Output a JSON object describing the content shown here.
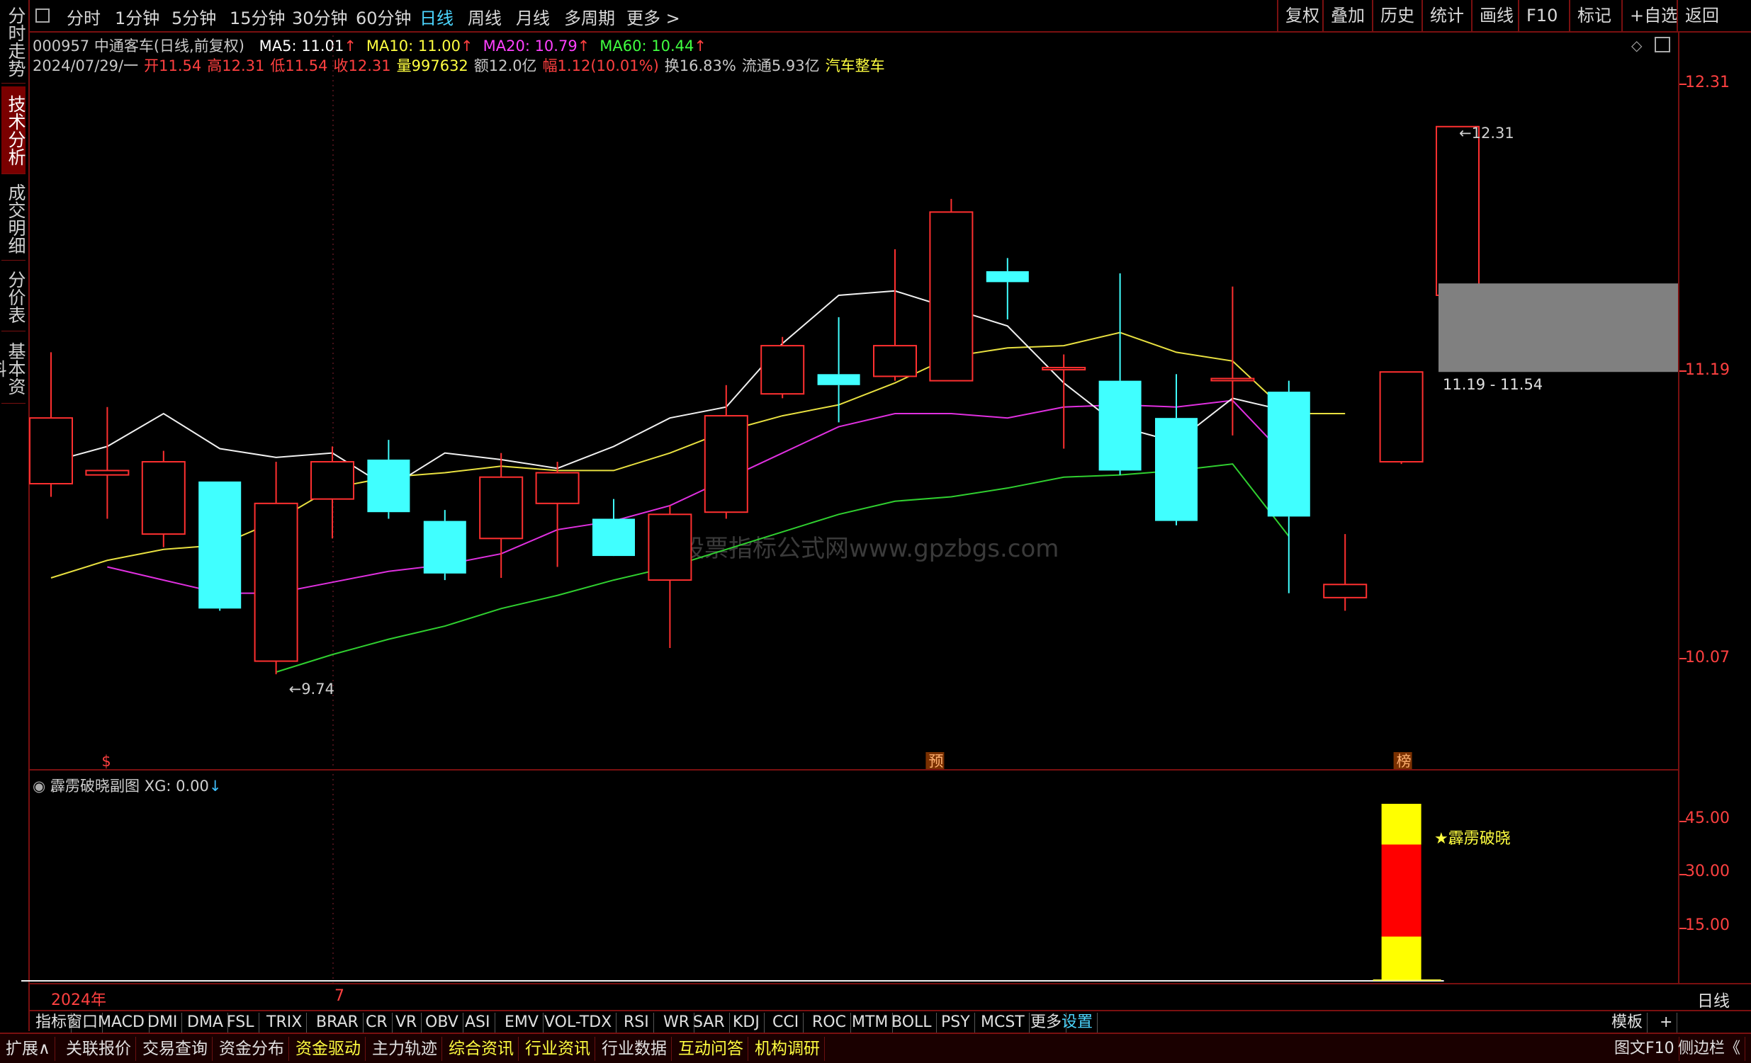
{
  "sidebar": [
    "分时走势",
    "技术分析",
    "成交明细",
    "分价表",
    "基本资料"
  ],
  "periods": [
    "分时",
    "1分钟",
    "5分钟",
    "15分钟",
    "30分钟",
    "60分钟",
    "日线",
    "周线",
    "月线",
    "多周期",
    "更多 >"
  ],
  "active_period": "日线",
  "toolbar": [
    "复权",
    "叠加",
    "历史",
    "统计",
    "画线",
    "F10",
    "标记",
    "+自选",
    "返回"
  ],
  "stock": {
    "code_name": "000957 中通客车(日线,前复权)"
  },
  "ma": [
    {
      "label": "MA5: 11.01",
      "color": "#ffffff"
    },
    {
      "label": "MA10: 11.00",
      "color": "#ffff40"
    },
    {
      "label": "MA20: 10.79",
      "color": "#ff40ff"
    },
    {
      "label": "MA60: 10.44",
      "color": "#40ff40"
    }
  ],
  "quote": [
    {
      "t": "2024/07/29/一",
      "c": "#c8c8c8"
    },
    {
      "t": "开11.54",
      "c": "#ff4040"
    },
    {
      "t": "高12.31",
      "c": "#ff4040"
    },
    {
      "t": "低11.54",
      "c": "#ff4040"
    },
    {
      "t": "收12.31",
      "c": "#ff4040"
    },
    {
      "t": "量997632",
      "c": "#ffff40"
    },
    {
      "t": "额12.0亿",
      "c": "#c8c8c8"
    },
    {
      "t": "幅1.12(10.01%)",
      "c": "#ff4040"
    },
    {
      "t": "换16.83%",
      "c": "#c8c8c8"
    },
    {
      "t": "流通5.93亿",
      "c": "#c8c8c8"
    },
    {
      "t": "汽车整车",
      "c": "#ffff40"
    }
  ],
  "price_axis": [
    "12.31",
    "11.19",
    "10.07"
  ],
  "vol_axis": [
    "45.00",
    "30.00",
    "15.00"
  ],
  "annotations": {
    "high": "12.31",
    "low": "9.74",
    "gap": "11.19 - 11.54",
    "markers": [
      "$",
      "预",
      "榜"
    ]
  },
  "watermark": "股票指标公式网www.gpzbgs.com",
  "sub_title": "霹雳破晓副图",
  "xg": "XG: 0.00",
  "signal_label": "霹雳破晓",
  "timeline": {
    "year": "2024年",
    "month": "7"
  },
  "period_indicator": "日线",
  "indicators": [
    "指标",
    "窗口",
    "MACD",
    "DMI",
    "DMA",
    "FSL",
    "TRIX",
    "BRAR",
    "CR",
    "VR",
    "OBV",
    "ASI",
    "EMV",
    "VOL-TDX",
    "RSI",
    "WR",
    "SAR",
    "KDJ",
    "CCI",
    "ROC",
    "MTM",
    "BOLL",
    "PSY",
    "MCST",
    "更多",
    "设置"
  ],
  "indicator_right": [
    "模板",
    "+"
  ],
  "bottom": [
    "扩展∧",
    "关联报价",
    "交易查询",
    "资金分布",
    "资金驱动",
    "主力轨迹",
    "综合资讯",
    "行业资讯",
    "行业数据",
    "互动问答",
    "机构调研"
  ],
  "bottom_right": [
    "图文F10",
    "侧边栏《"
  ],
  "chart_data": {
    "type": "candlestick",
    "price_range": [
      9.5,
      12.5
    ],
    "candles": [
      {
        "o": 10.68,
        "c": 10.98,
        "h": 11.28,
        "l": 10.62
      },
      {
        "o": 10.72,
        "c": 10.74,
        "h": 11.03,
        "l": 10.52
      },
      {
        "o": 10.45,
        "c": 10.78,
        "h": 10.83,
        "l": 10.39
      },
      {
        "o": 10.69,
        "c": 10.11,
        "h": 10.69,
        "l": 10.1
      },
      {
        "o": 9.87,
        "c": 10.59,
        "h": 10.78,
        "l": 9.81
      },
      {
        "o": 10.61,
        "c": 10.78,
        "h": 10.85,
        "l": 10.43
      },
      {
        "o": 10.79,
        "c": 10.55,
        "h": 10.88,
        "l": 10.52
      },
      {
        "o": 10.51,
        "c": 10.27,
        "h": 10.56,
        "l": 10.24
      },
      {
        "o": 10.43,
        "c": 10.71,
        "h": 10.82,
        "l": 10.25
      },
      {
        "o": 10.59,
        "c": 10.73,
        "h": 10.78,
        "l": 10.3
      },
      {
        "o": 10.52,
        "c": 10.35,
        "h": 10.61,
        "l": 10.37
      },
      {
        "o": 10.24,
        "c": 10.54,
        "h": 10.58,
        "l": 9.93
      },
      {
        "o": 10.55,
        "c": 10.99,
        "h": 11.13,
        "l": 10.52
      },
      {
        "o": 11.09,
        "c": 11.31,
        "h": 11.35,
        "l": 11.07
      },
      {
        "o": 11.18,
        "c": 11.13,
        "h": 11.44,
        "l": 10.96
      },
      {
        "o": 11.17,
        "c": 11.31,
        "h": 11.75,
        "l": 11.15
      },
      {
        "o": 11.15,
        "c": 11.92,
        "h": 11.98,
        "l": 11.15
      },
      {
        "o": 11.65,
        "c": 11.6,
        "h": 11.71,
        "l": 11.43
      },
      {
        "o": 11.21,
        "c": 11.21,
        "h": 11.27,
        "l": 10.84
      },
      {
        "o": 11.15,
        "c": 10.74,
        "h": 11.64,
        "l": 10.72
      },
      {
        "o": 10.98,
        "c": 10.51,
        "h": 11.18,
        "l": 10.49
      },
      {
        "o": 11.16,
        "c": 11.16,
        "h": 11.58,
        "l": 10.9
      },
      {
        "o": 11.1,
        "c": 10.53,
        "h": 11.15,
        "l": 10.18
      },
      {
        "o": 10.16,
        "c": 10.22,
        "h": 10.45,
        "l": 10.1
      },
      {
        "o": 10.78,
        "c": 11.19,
        "h": 11.19,
        "l": 10.77
      },
      {
        "o": 11.54,
        "c": 12.31,
        "h": 12.31,
        "l": 11.54
      }
    ],
    "ma5": [
      10.78,
      10.85,
      11.0,
      10.84,
      10.8,
      10.82,
      10.66,
      10.82,
      10.79,
      10.75,
      10.85,
      10.98,
      11.03,
      11.32,
      11.54,
      11.56,
      11.48,
      11.4,
      11.14,
      10.94,
      10.87,
      11.07,
      11.01
    ],
    "ma10": [
      10.25,
      10.33,
      10.38,
      10.4,
      10.51,
      10.66,
      10.71,
      10.73,
      10.76,
      10.74,
      10.74,
      10.82,
      10.92,
      10.99,
      11.04,
      11.14,
      11.26,
      11.3,
      11.31,
      11.37,
      11.28,
      11.24,
      11.0,
      11.0
    ],
    "ma20": [
      10.3,
      10.24,
      10.18,
      10.18,
      10.23,
      10.28,
      10.31,
      10.36,
      10.47,
      10.51,
      10.58,
      10.7,
      10.82,
      10.94,
      11.0,
      11.0,
      10.98,
      11.03,
      11.04,
      11.03,
      11.06,
      10.79
    ],
    "ma60": [
      9.82,
      9.9,
      9.97,
      10.03,
      10.11,
      10.17,
      10.24,
      10.3,
      10.38,
      10.46,
      10.54,
      10.6,
      10.62,
      10.66,
      10.71,
      10.72,
      10.74,
      10.77,
      10.44
    ],
    "signal": {
      "bar_index": 24,
      "levels": [
        0,
        12.5,
        38.5,
        50
      ],
      "colors": [
        "#ffff00",
        "#ff0000",
        "#ffff00"
      ]
    }
  }
}
